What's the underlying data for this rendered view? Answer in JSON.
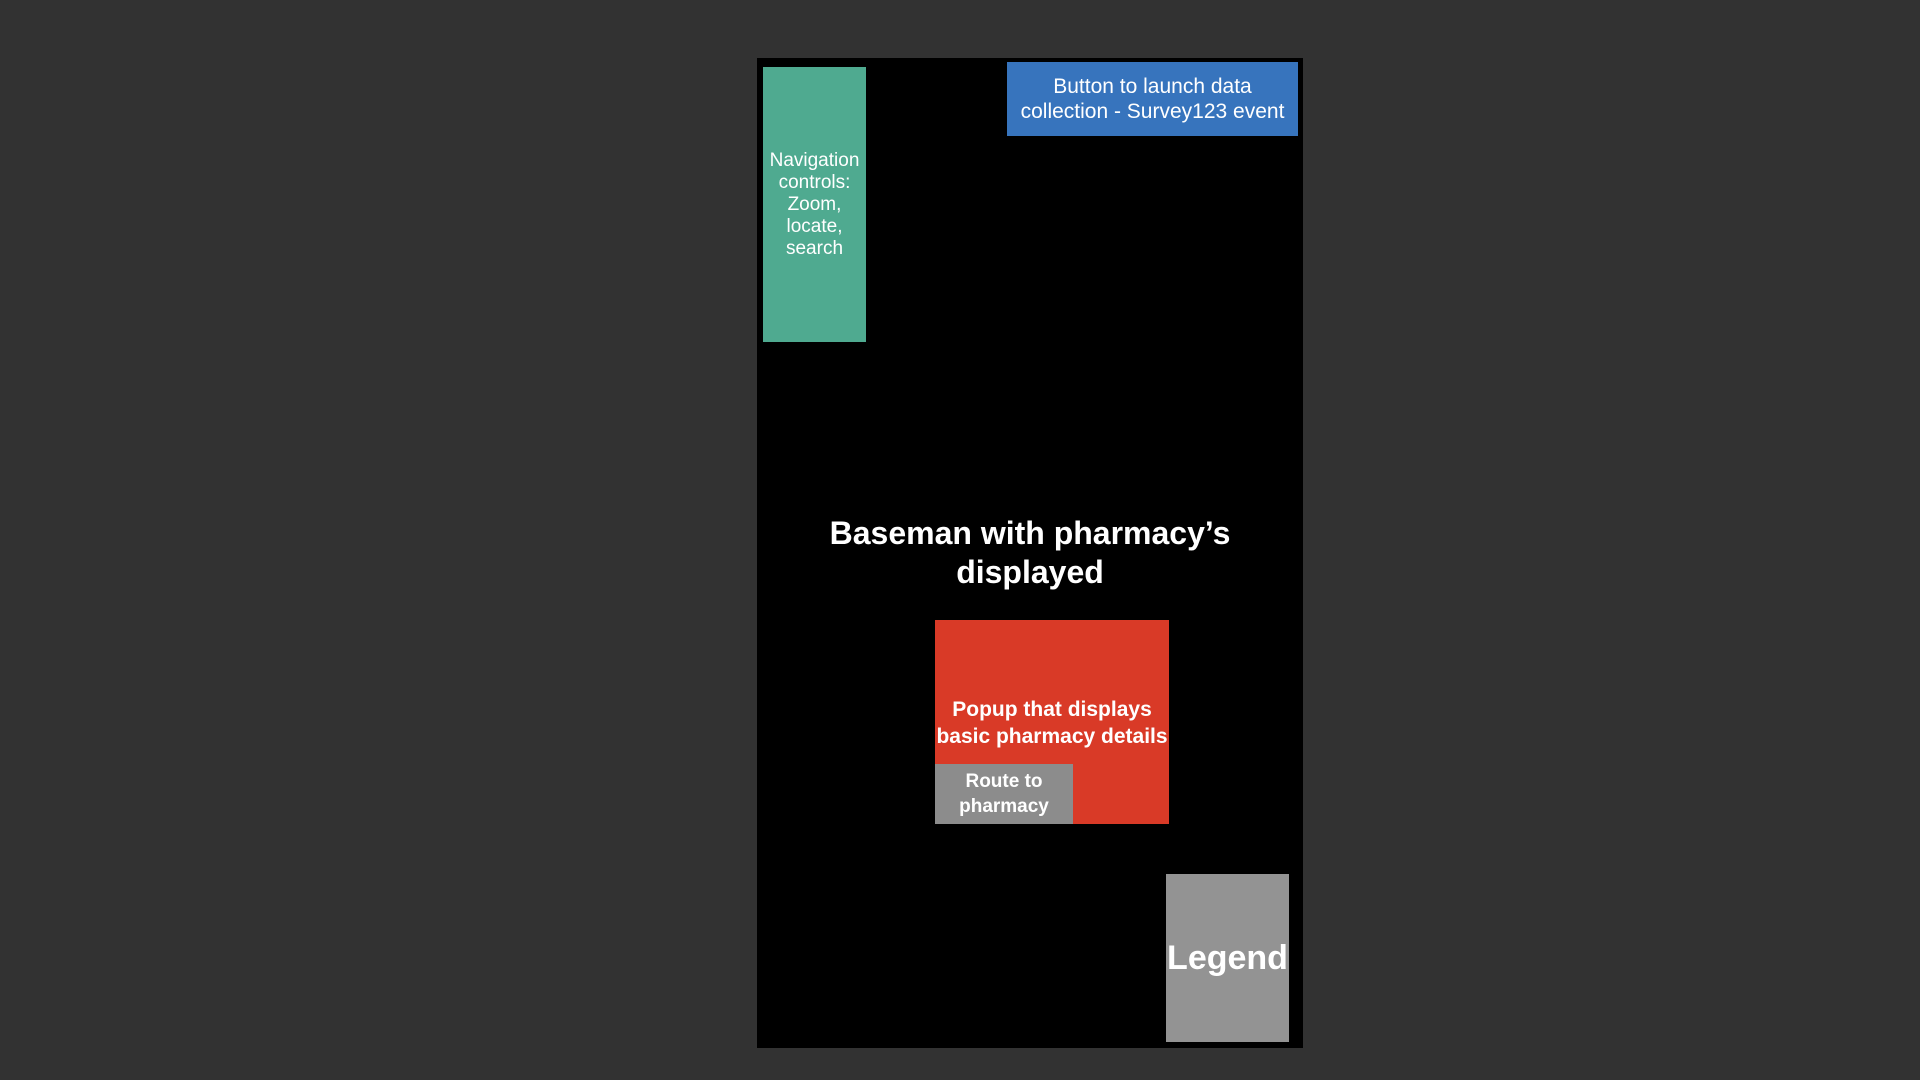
{
  "navigation": {
    "label": "Navigation controls: Zoom, locate, search"
  },
  "launch_button": {
    "label": "Button to launch data collection - Survey123 event"
  },
  "basemap": {
    "label": "Baseman with pharmacy’s displayed"
  },
  "popup": {
    "label": "Popup that displays basic pharmacy details",
    "route_label": "Route to pharmacy"
  },
  "legend": {
    "label": "Legend"
  },
  "colors": {
    "background": "#323232",
    "screen": "#000000",
    "navigation": "#4faa90",
    "launch_button": "#3774bd",
    "popup": "#d93a27",
    "route": "#8c8c8c",
    "legend": "#939393"
  }
}
